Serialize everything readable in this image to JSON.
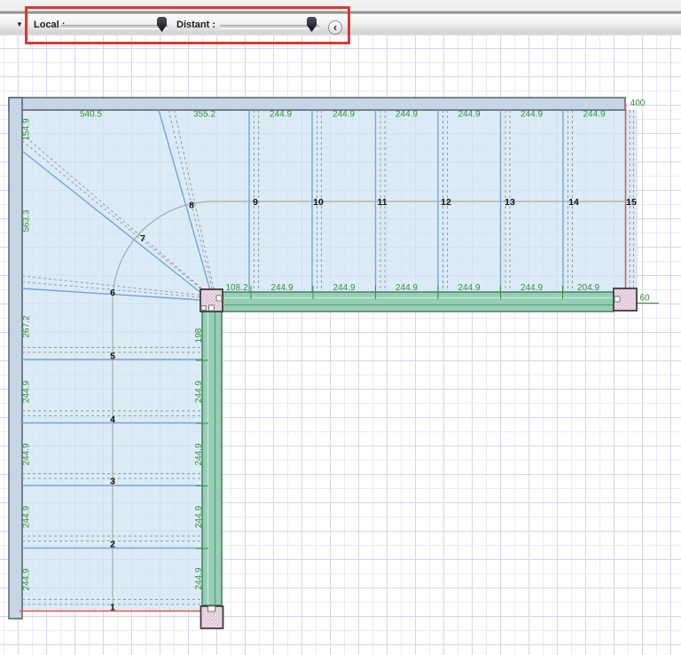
{
  "toolbar": {
    "overflow_glyph": "▼",
    "local_label": "Local :",
    "distant_label": "Distant :",
    "collapse_glyph": "‹",
    "highlight_color": "#dc392c"
  },
  "plan": {
    "dim_color": "#359235",
    "stair_fill": "#cde5f3",
    "beam_fill": "#95cfb4",
    "post_fill": "#eadeea",
    "flight_edge_color": "#e8544a",
    "top_dims": [
      "540.5",
      "355.2",
      "244.9",
      "244.9",
      "244.9",
      "244.9",
      "244.9",
      "244.9"
    ],
    "top_right_dim": "400",
    "left_dims": [
      "154.9",
      "563.3",
      "267.2",
      "244.9",
      "244.9",
      "244.9",
      "244.9"
    ],
    "beam_dims": [
      "108.2",
      "244.9",
      "244.9",
      "244.9",
      "244.9",
      "244.9",
      "204.9"
    ],
    "beam_end_dim": "60",
    "vertical_beam_dims": [
      "198",
      "244.9",
      "244.9",
      "244.9",
      "244.9"
    ],
    "step_numbers": [
      "1",
      "2",
      "3",
      "4",
      "5",
      "6",
      "7",
      "8",
      "9",
      "10",
      "11",
      "12",
      "13",
      "14",
      "15"
    ]
  }
}
